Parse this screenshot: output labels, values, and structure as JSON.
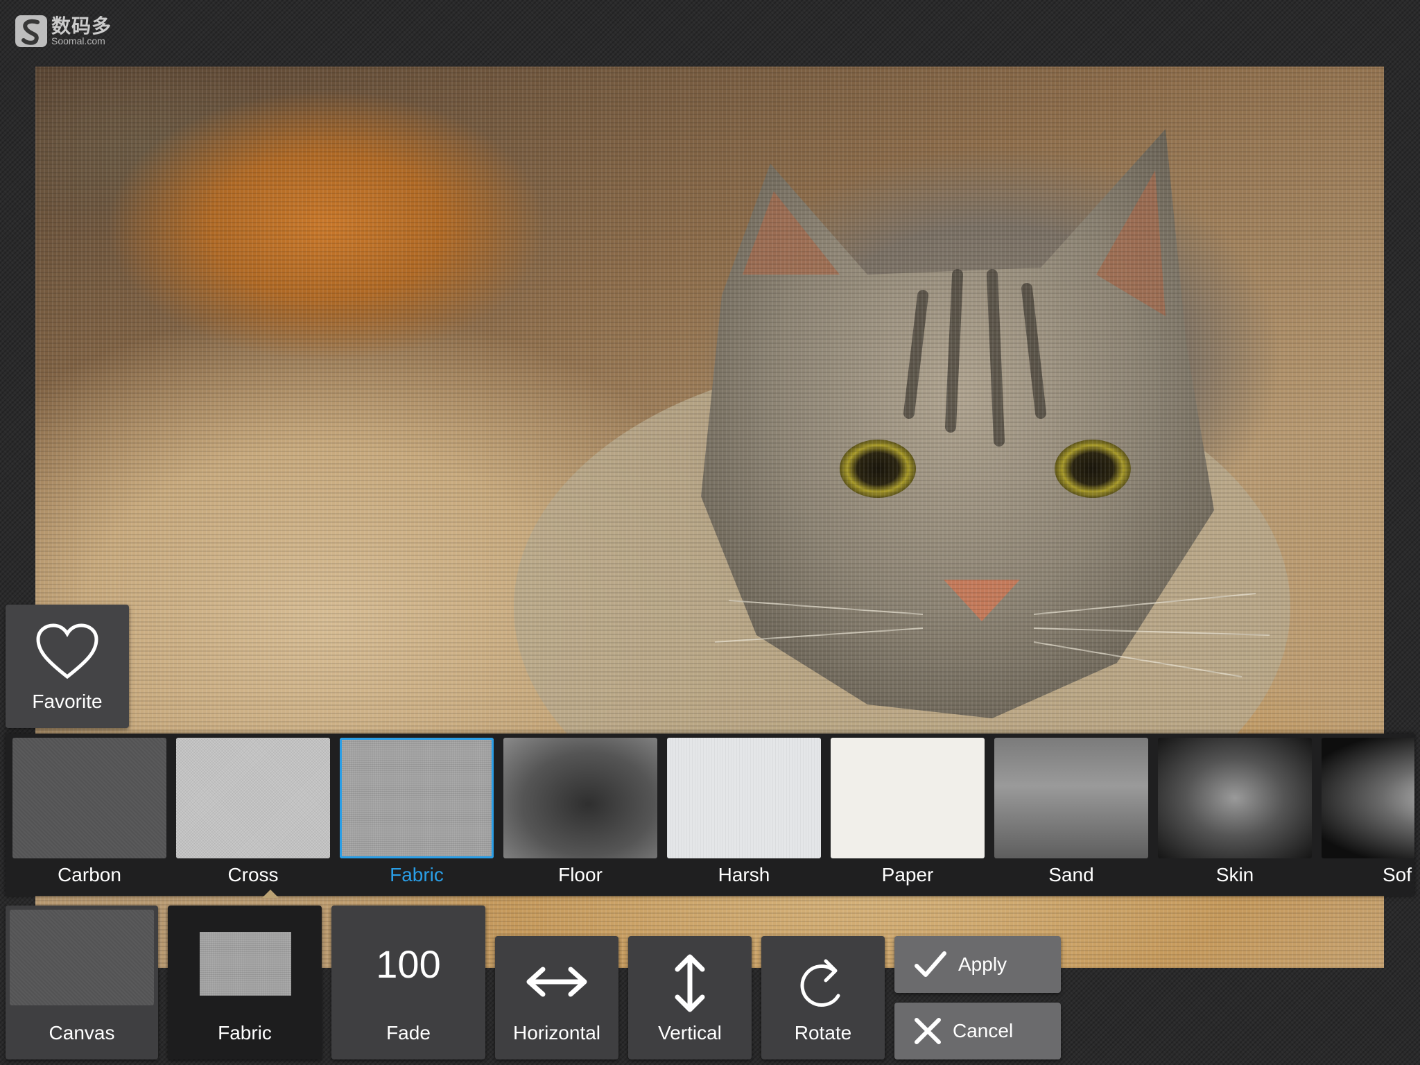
{
  "watermark": {
    "cn": "数码多",
    "en": "Soomal.com"
  },
  "favorite": {
    "label": "Favorite"
  },
  "textures": {
    "selected": "Fabric",
    "items": [
      {
        "label": "Carbon"
      },
      {
        "label": "Cross"
      },
      {
        "label": "Fabric"
      },
      {
        "label": "Floor"
      },
      {
        "label": "Harsh"
      },
      {
        "label": "Paper"
      },
      {
        "label": "Sand"
      },
      {
        "label": "Skin"
      },
      {
        "label": "Sof"
      }
    ]
  },
  "toolbar": {
    "canvas_label": "Canvas",
    "fabric_label": "Fabric",
    "fade_value": "100",
    "fade_label": "Fade",
    "horizontal_label": "Horizontal",
    "vertical_label": "Vertical",
    "rotate_label": "Rotate",
    "apply_label": "Apply",
    "cancel_label": "Cancel"
  },
  "colors": {
    "accent": "#2a9ee6",
    "background": "#2a2a2b",
    "button": "#3f3f41"
  },
  "icons": [
    "heart-icon",
    "horizontal-flip-icon",
    "vertical-flip-icon",
    "rotate-icon",
    "check-icon",
    "close-icon"
  ]
}
